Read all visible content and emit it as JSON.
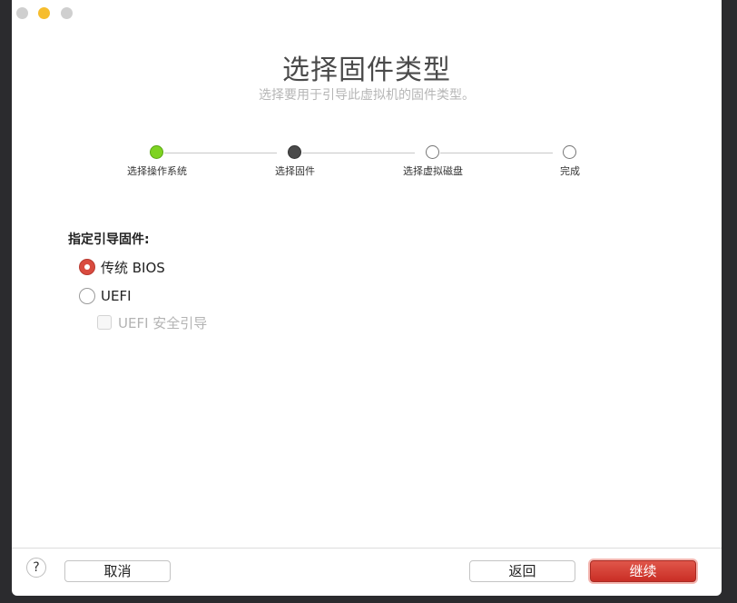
{
  "window": {
    "traffic_lights": [
      "close",
      "minimize",
      "zoom"
    ]
  },
  "header": {
    "title": "选择固件类型",
    "subtitle": "选择要用于引导此虚拟机的固件类型。"
  },
  "steps": [
    {
      "label": "选择操作系统",
      "state": "done"
    },
    {
      "label": "选择固件",
      "state": "current"
    },
    {
      "label": "选择虚拟磁盘",
      "state": "todo"
    },
    {
      "label": "完成",
      "state": "todo"
    }
  ],
  "colors": {
    "accent_red": "#d94b3f",
    "step_done": "#7ed321",
    "step_current": "#4a4a4a"
  },
  "firmware": {
    "section_label": "指定引导固件:",
    "options": [
      {
        "label": "传统 BIOS",
        "selected": true
      },
      {
        "label": "UEFI",
        "selected": false
      }
    ],
    "secure_boot": {
      "label": "UEFI 安全引导",
      "checked": false,
      "disabled": true
    }
  },
  "footer": {
    "help": "?",
    "cancel": "取消",
    "back": "返回",
    "continue": "继续"
  }
}
